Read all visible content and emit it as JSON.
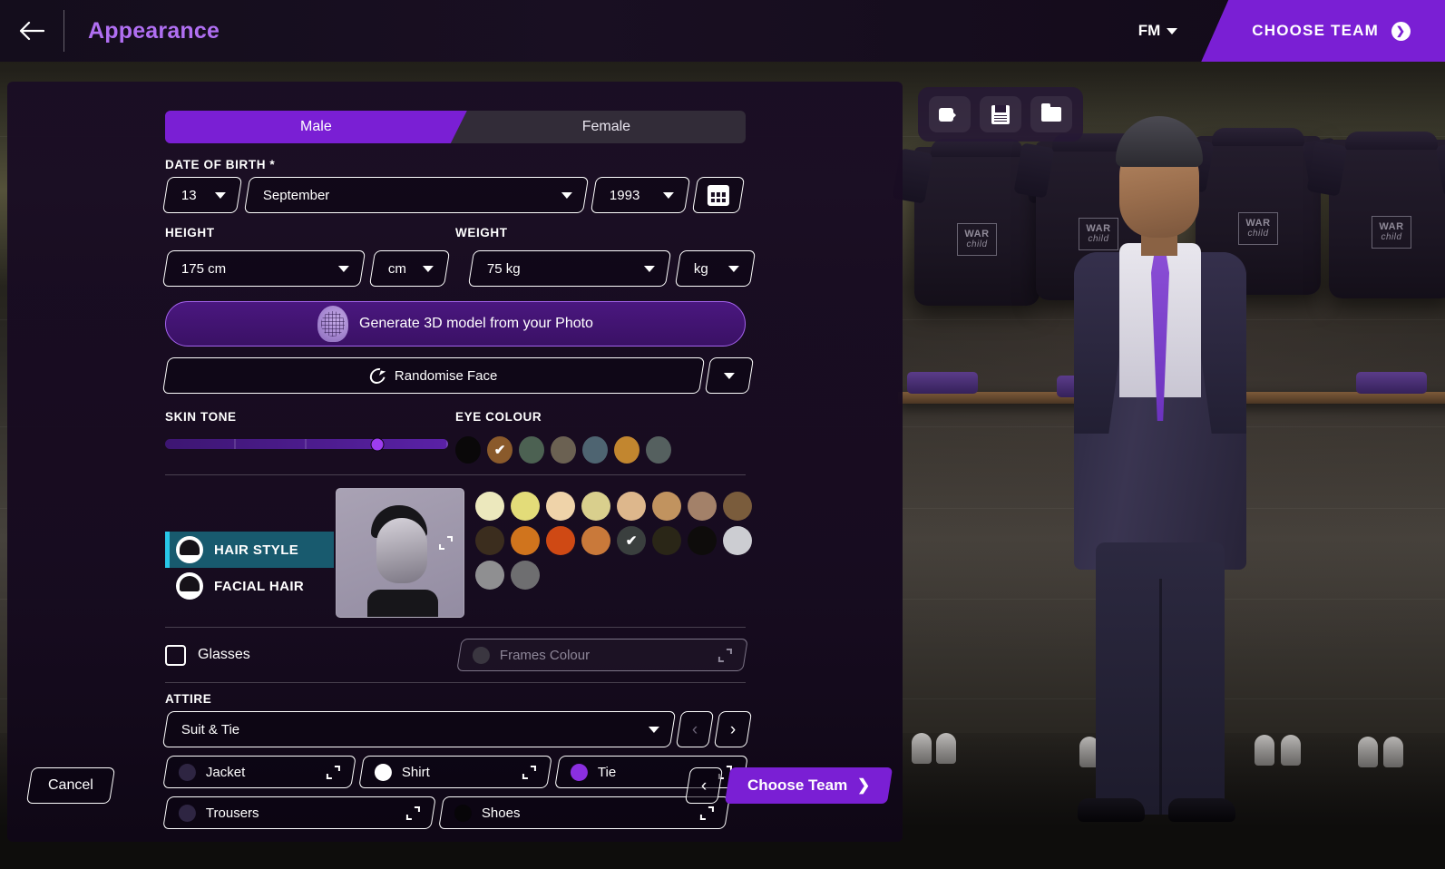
{
  "topbar": {
    "back_icon": "arrow-left-icon",
    "title": "Appearance",
    "fm_label": "FM",
    "choose_team_label": "CHOOSE TEAM"
  },
  "view_tools": [
    {
      "name": "video-camera-icon",
      "label": ""
    },
    {
      "name": "save-icon",
      "label": ""
    },
    {
      "name": "folder-icon",
      "label": ""
    }
  ],
  "gender": {
    "options": [
      "Male",
      "Female"
    ],
    "selected": "Male"
  },
  "date_of_birth": {
    "label": "DATE OF BIRTH *",
    "day": "13",
    "month": "September",
    "year": "1993",
    "calendar_icon": "calendar-icon"
  },
  "height": {
    "label": "HEIGHT",
    "value": "175 cm",
    "unit": "cm"
  },
  "weight": {
    "label": "WEIGHT",
    "value": "75 kg",
    "unit": "kg"
  },
  "actions": {
    "generate_label": "Generate 3D model from your Photo",
    "randomise_label": "Randomise Face"
  },
  "skin_tone": {
    "label": "SKIN TONE",
    "value_percent": 75
  },
  "eye_colour": {
    "label": "EYE COLOUR",
    "selected_index": 1,
    "swatches": [
      "#0a0809",
      "#8a5a2b",
      "#4c6152",
      "#6b6152",
      "#4e6471",
      "#c2862f",
      "#55605f"
    ]
  },
  "hair_colour": {
    "selected_index": 12,
    "swatches": [
      "#ece8bd",
      "#e3dc79",
      "#efd3a9",
      "#d9cf8d",
      "#ddb78c",
      "#c1935f",
      "#a38169",
      "#7a5c3c",
      "#3b2d1e",
      "#d0741d",
      "#cf4914",
      "#c9793a",
      "#3a3f3e",
      "#2a2617",
      "#0e0c0b",
      "#cccdd2",
      "#8f8f91",
      "#6e6e70"
    ]
  },
  "appearance_tabs": [
    {
      "label": "HAIR STYLE",
      "selected": true
    },
    {
      "label": "FACIAL HAIR",
      "selected": false
    }
  ],
  "face_preview": {
    "name": "face-preview-thumbnail",
    "expand_icon": "expand-icon"
  },
  "glasses": {
    "label": "Glasses",
    "checked": false,
    "frames_colour_label": "Frames Colour",
    "frames_colour": "#3a3640",
    "enabled": false
  },
  "attire": {
    "label": "ATTIRE",
    "selected": "Suit & Tie",
    "prev_arrow": "‹",
    "next_arrow": "›",
    "items": [
      {
        "label": "Jacket",
        "colour": "#2e2542"
      },
      {
        "label": "Shirt",
        "colour": "#ffffff"
      },
      {
        "label": "Tie",
        "colour": "#8b2fe0"
      },
      {
        "label": "Trousers",
        "colour": "#2e2542"
      },
      {
        "label": "Shoes",
        "colour": "#070508"
      }
    ]
  },
  "footer": {
    "cancel_label": "Cancel",
    "back_arrow": "‹",
    "choose_team_label": "Choose Team",
    "choose_team_arrow": "❯"
  },
  "scene": {
    "jersey_logo_top": "WAR",
    "jersey_logo_bottom": "child"
  },
  "theme": {
    "accent_purple": "#7a1fd4",
    "title_purple": "#b06ff2",
    "tab_teal": "#185a6e",
    "tab_accent": "#28c7e8"
  }
}
